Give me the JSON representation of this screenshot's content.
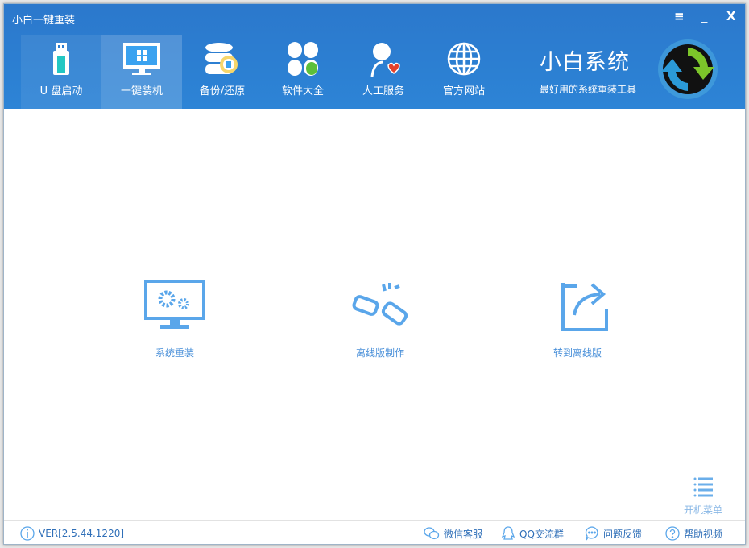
{
  "window": {
    "title": "小白一键重装",
    "menu_icon": "menu-icon",
    "minimize": "_",
    "close": "X"
  },
  "tabs": [
    {
      "label": "U 盘启动",
      "icon": "usb-icon"
    },
    {
      "label": "一键装机",
      "icon": "monitor-icon",
      "active": true
    },
    {
      "label": "备份/还原",
      "icon": "database-icon"
    },
    {
      "label": "软件大全",
      "icon": "apps-icon"
    },
    {
      "label": "人工服务",
      "icon": "person-heart-icon"
    },
    {
      "label": "官方网站",
      "icon": "globe-icon"
    }
  ],
  "brand": {
    "name": "小白系统",
    "slogan": "最好用的系统重装工具"
  },
  "actions": [
    {
      "label": "系统重装",
      "icon": "monitor-gears-icon"
    },
    {
      "label": "离线版制作",
      "icon": "broken-link-icon"
    },
    {
      "label": "转到离线版",
      "icon": "share-icon"
    }
  ],
  "boot_menu": {
    "label": "开机菜单",
    "icon": "list-icon"
  },
  "footer": {
    "version": "VER[2.5.44.1220]",
    "links": [
      {
        "label": "微信客服",
        "icon": "wechat-icon"
      },
      {
        "label": "QQ交流群",
        "icon": "qq-icon"
      },
      {
        "label": "问题反馈",
        "icon": "chat-icon"
      },
      {
        "label": "帮助视频",
        "icon": "help-icon"
      }
    ]
  },
  "colors": {
    "header": "#2b7dd2",
    "accent": "#4a90d9"
  }
}
